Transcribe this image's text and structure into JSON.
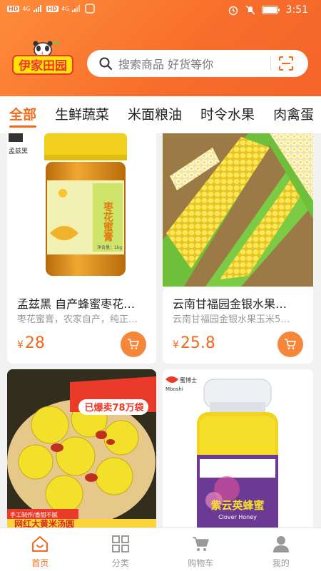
{
  "status_bar": {
    "left_indicators": [
      "HD",
      "4G",
      "HD",
      "4G"
    ],
    "time": "3:51"
  },
  "logo_text": "伊家田园",
  "search": {
    "placeholder": "搜索商品 好货等你"
  },
  "tabs": [
    {
      "label": "全部",
      "active": true
    },
    {
      "label": "生鲜蔬菜",
      "active": false
    },
    {
      "label": "米面粮油",
      "active": false
    },
    {
      "label": "时令水果",
      "active": false
    },
    {
      "label": "肉禽蛋",
      "active": false
    }
  ],
  "products": [
    {
      "title": "孟兹黑 自产蜂蜜枣花蜜…",
      "desc": "枣花蜜膏，农家自产，纯正…",
      "currency": "¥",
      "price": "28",
      "image_brand": "孟兹黑",
      "image_label": "枣花蜜膏",
      "image_net": "净含量：1kg"
    },
    {
      "title": "云南甘福园金银水果…",
      "desc": "云南甘福园金银水果玉米5…",
      "currency": "¥",
      "price": "25.8"
    },
    {
      "image_banner": "已爆卖78万袋",
      "image_tagline": "手工制作/香甜不腻",
      "image_bottom": "网红大黄米汤圆"
    },
    {
      "image_brand": "蜜博士",
      "image_brand_en": "Mboshi",
      "image_label": "紫云英蜂蜜",
      "image_label_en": "Clover Honey"
    }
  ],
  "bottom_nav": [
    {
      "label": "首页",
      "icon": "home-icon",
      "active": true
    },
    {
      "label": "分类",
      "icon": "grid-icon",
      "active": false
    },
    {
      "label": "购物车",
      "icon": "cart-icon",
      "active": false
    },
    {
      "label": "我的",
      "icon": "user-icon",
      "active": false
    }
  ],
  "colors": {
    "accent": "#f26a1b",
    "header_start": "#fe8c3a",
    "header_end": "#f5642a",
    "cart_button": "#f5863a"
  }
}
